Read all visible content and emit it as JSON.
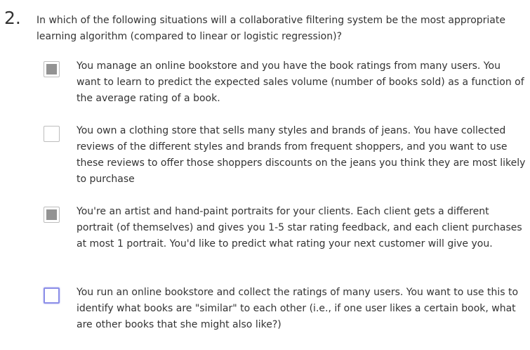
{
  "question": {
    "number": "2.",
    "text": "In which of the following situations will a collaborative filtering system be the most appropriate learning algorithm (compared to linear or logistic regression)?"
  },
  "options": [
    {
      "text": "You manage an online bookstore and you have the book ratings from many users. You want to learn to predict the expected sales volume (number of books sold) as a function of the average rating of a book.",
      "checked": true
    },
    {
      "text": "You own a clothing store that sells many styles and brands of jeans. You have collected reviews of the different styles and brands from frequent shoppers, and you want to use these reviews to offer those shoppers discounts on the jeans you think they are most likely to purchase",
      "checked": false
    },
    {
      "text": "You're an artist and hand-paint portraits for your clients. Each client gets a different portrait (of themselves) and gives you 1-5 star rating feedback, and each client purchases at most 1 portrait. You'd like to predict what rating your next customer will give you.",
      "checked": true
    },
    {
      "text": "You run an online bookstore and collect the ratings of many users. You want to use this to identify what books are \"similar\" to each other (i.e., if one user likes a certain book, what are other books that she might also like?)",
      "checked": false,
      "focused": true
    }
  ]
}
